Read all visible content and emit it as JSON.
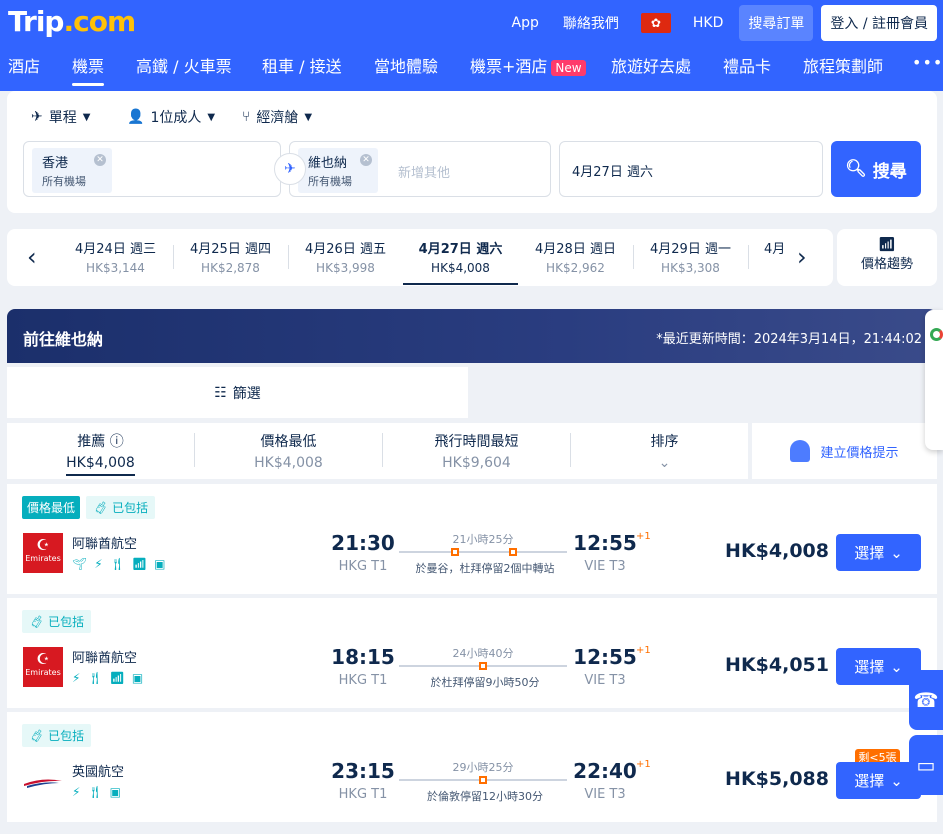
{
  "header": {
    "logo": "Trip",
    "logo_suffix": ".com",
    "links": [
      "App",
      "聯絡我們"
    ],
    "currency": "HKD",
    "orders_button": "搜尋訂單",
    "login_button": "登入 / 註冊會員"
  },
  "nav": {
    "items": [
      {
        "label": "酒店"
      },
      {
        "label": "機票",
        "active": true
      },
      {
        "label": "高鐵 / 火車票"
      },
      {
        "label": "租車 / 接送"
      },
      {
        "label": "當地體驗"
      },
      {
        "label": "機票+酒店",
        "badge": "New"
      },
      {
        "label": "旅遊好去處"
      },
      {
        "label": "禮品卡"
      },
      {
        "label": "旅程策劃師"
      }
    ],
    "more": "•••"
  },
  "search": {
    "trip_type": "單程",
    "passengers": "1位成人",
    "cabin": "經濟艙",
    "from_city": "香港",
    "from_sub": "所有機場",
    "to_city": "維也納",
    "to_sub": "所有機場",
    "add_placeholder": "新增其他",
    "date": "4月27日 週六",
    "search_button": "搜尋"
  },
  "dates": [
    {
      "date": "4月24日 週三",
      "price": "HK$3,144"
    },
    {
      "date": "4月25日 週四",
      "price": "HK$2,878"
    },
    {
      "date": "4月26日 週五",
      "price": "HK$3,998"
    },
    {
      "date": "4月27日 週六",
      "price": "HK$4,008",
      "selected": true
    },
    {
      "date": "4月28日 週日",
      "price": "HK$2,962"
    },
    {
      "date": "4月29日 週一",
      "price": "HK$3,308"
    },
    {
      "date": "4月",
      "price": ""
    }
  ],
  "trend_label": "價格趨勢",
  "destination": {
    "title": "前往維也納",
    "updated": "*最近更新時間：2024年3月14日，21:44:02"
  },
  "filter_label": "篩選",
  "sort": [
    {
      "label": "推薦",
      "value": "HK$4,008",
      "active": true
    },
    {
      "label": "價格最低",
      "value": "HK$4,008"
    },
    {
      "label": "飛行時間最短",
      "value": "HK$9,604"
    },
    {
      "label": "排序",
      "value": ""
    }
  ],
  "price_alert": "建立價格提示",
  "flights": [
    {
      "tags": [
        "價格最低",
        "已包括"
      ],
      "airline": "阿聯酋航空",
      "logo": "Emirates",
      "depart": "21:30",
      "depart_ap": "HKG T1",
      "duration": "21小時25分",
      "via": "於曼谷，杜拜停留2個中轉站",
      "arrive": "12:55",
      "arrive_ap": "VIE T3",
      "day_offset": "+1",
      "price": "HK$4,008",
      "select": "選擇"
    },
    {
      "tags": [
        "已包括"
      ],
      "airline": "阿聯酋航空",
      "logo": "Emirates",
      "depart": "18:15",
      "depart_ap": "HKG T1",
      "duration": "24小時40分",
      "via": "於杜拜停留9小時50分",
      "arrive": "12:55",
      "arrive_ap": "VIE T3",
      "day_offset": "+1",
      "price": "HK$4,051",
      "select": "選擇"
    },
    {
      "tags": [
        "已包括"
      ],
      "airline": "英國航空",
      "depart": "23:15",
      "depart_ap": "HKG T1",
      "duration": "29小時25分",
      "via": "於倫敦停留12小時30分",
      "arrive": "22:40",
      "arrive_ap": "VIE T3",
      "day_offset": "+1",
      "price": "HK$5,088",
      "seats_left": "剩<5張",
      "select": "選擇"
    }
  ]
}
